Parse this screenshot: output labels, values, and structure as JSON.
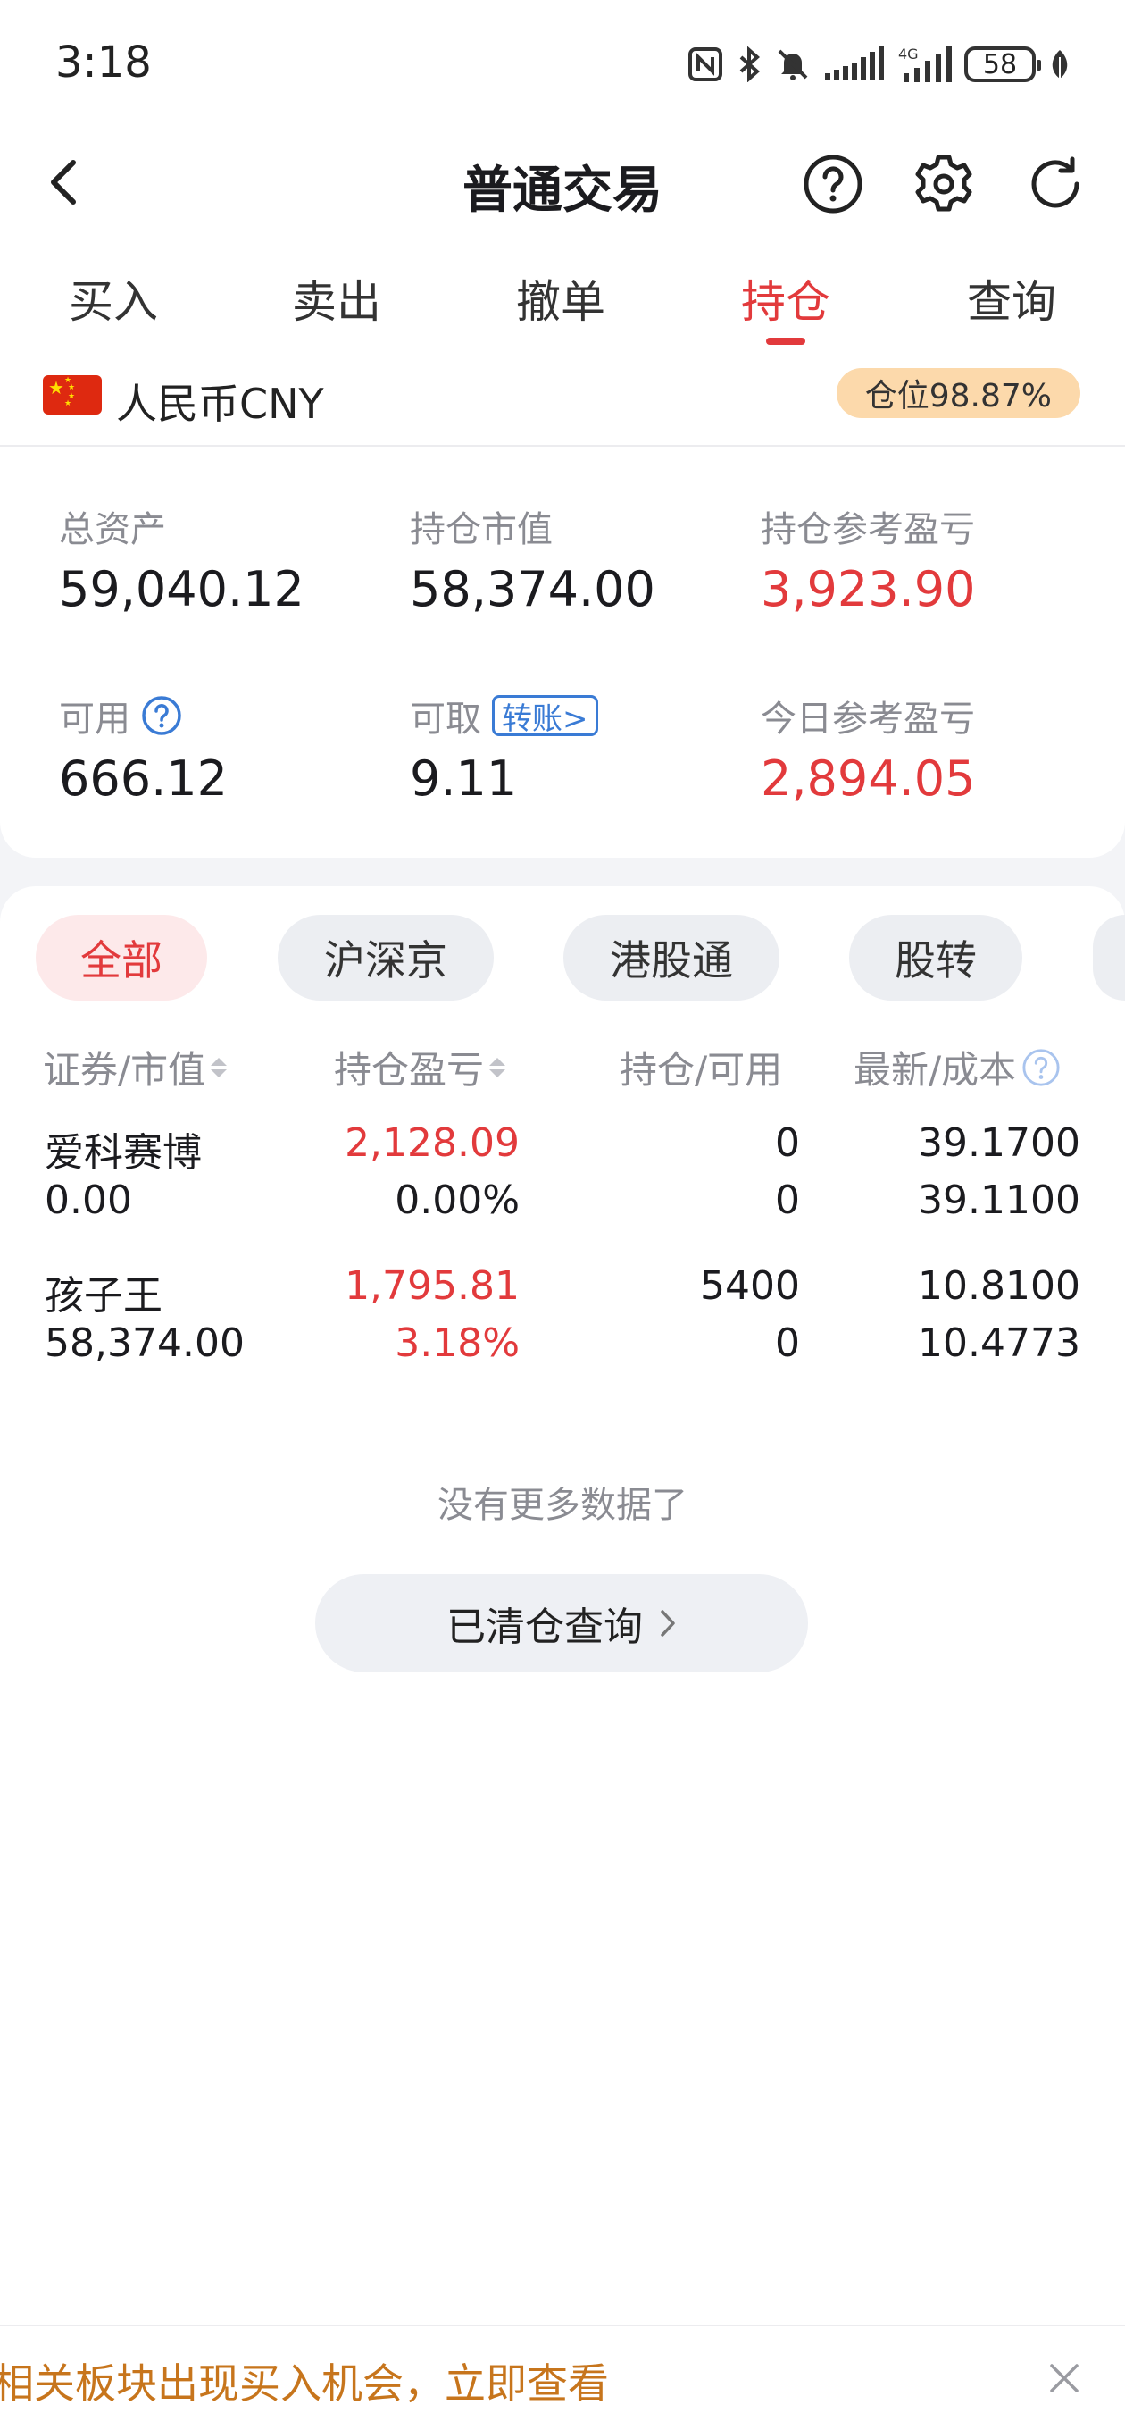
{
  "status_bar": {
    "time": "3:18",
    "battery": "58",
    "network": "4G",
    "icons": [
      "nfc-icon",
      "bluetooth-icon",
      "mute-icon",
      "signal-icon",
      "4g-signal-icon",
      "battery-icon",
      "leaf-icon"
    ]
  },
  "nav": {
    "title": "普通交易",
    "icons": [
      "back-icon",
      "help-icon",
      "settings-icon",
      "refresh-icon"
    ]
  },
  "tabs": [
    {
      "label": "买入",
      "active": false
    },
    {
      "label": "卖出",
      "active": false
    },
    {
      "label": "撤单",
      "active": false
    },
    {
      "label": "持仓",
      "active": true
    },
    {
      "label": "查询",
      "active": false
    }
  ],
  "account": {
    "currency": "人民币CNY",
    "position_ratio": "仓位98.87%"
  },
  "summary": {
    "total_assets_label": "总资产",
    "total_assets": "59,040.12",
    "market_value_label": "持仓市值",
    "market_value": "58,374.00",
    "position_pnl_label": "持仓参考盈亏",
    "position_pnl": "3,923.90",
    "available_label": "可用",
    "available": "666.12",
    "withdrawable_label": "可取",
    "withdrawable": "9.11",
    "transfer_label": "转账>",
    "today_pnl_label": "今日参考盈亏",
    "today_pnl": "2,894.05"
  },
  "filters": [
    {
      "label": "全部",
      "active": true
    },
    {
      "label": "沪深京",
      "active": false
    },
    {
      "label": "港股通",
      "active": false
    },
    {
      "label": "股转",
      "active": false
    }
  ],
  "table": {
    "headers": [
      "证券/市值",
      "持仓盈亏",
      "持仓/可用",
      "最新/成本"
    ],
    "rows": [
      {
        "name": "爱科赛博",
        "market_value": "0.00",
        "pnl": "2,128.09",
        "pnl_pct": "0.00%",
        "holding": "0",
        "available": "0",
        "latest": "39.1700",
        "cost": "39.1100"
      },
      {
        "name": "孩子王",
        "market_value": "58,374.00",
        "pnl": "1,795.81",
        "pnl_pct": "3.18%",
        "holding": "5400",
        "available": "0",
        "latest": "10.8100",
        "cost": "10.4773"
      }
    ]
  },
  "no_more": "没有更多数据了",
  "cleared_button": "已清仓查询",
  "banner": {
    "text": "相关板块出现买入机会，立即查看"
  },
  "colors": {
    "accent": "#e23a3c",
    "badge_bg": "#fcd9ab",
    "banner_text": "#c7751c",
    "link_blue": "#3a7bd5"
  }
}
